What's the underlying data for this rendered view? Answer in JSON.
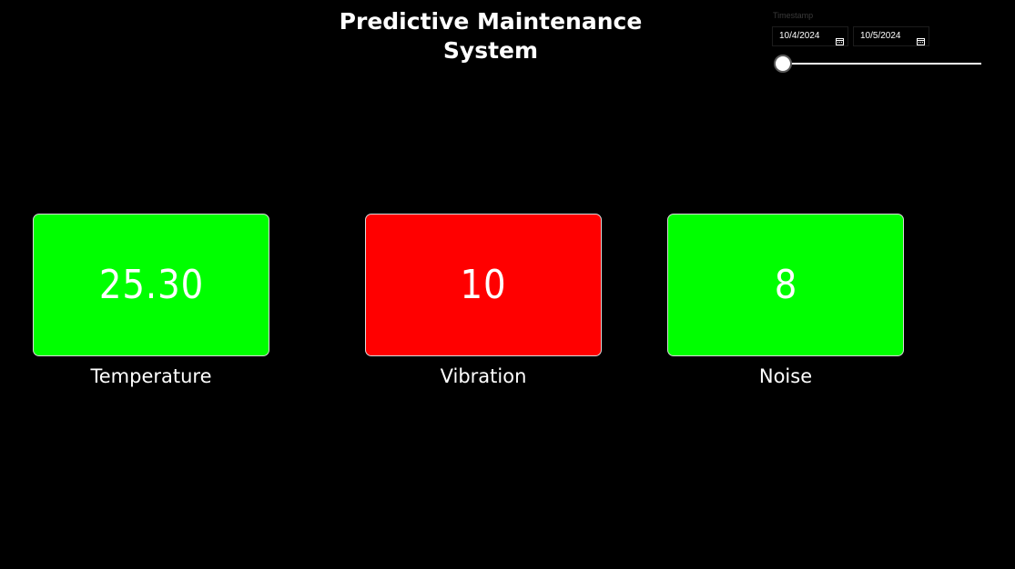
{
  "header": {
    "title": "Predictive Maintenance System"
  },
  "slicer": {
    "label": "Timestamp",
    "start_date": "10/4/2024",
    "end_date": "10/5/2024",
    "start_icon": "calendar-icon",
    "end_icon": "calendar-icon",
    "slider_position": 0
  },
  "cards": [
    {
      "value": "25.30",
      "label": "Temperature",
      "status_color": "#00ff00"
    },
    {
      "value": "10",
      "label": "Vibration",
      "status_color": "#ff0000"
    },
    {
      "value": "8",
      "label": "Noise",
      "status_color": "#00ff00"
    }
  ]
}
